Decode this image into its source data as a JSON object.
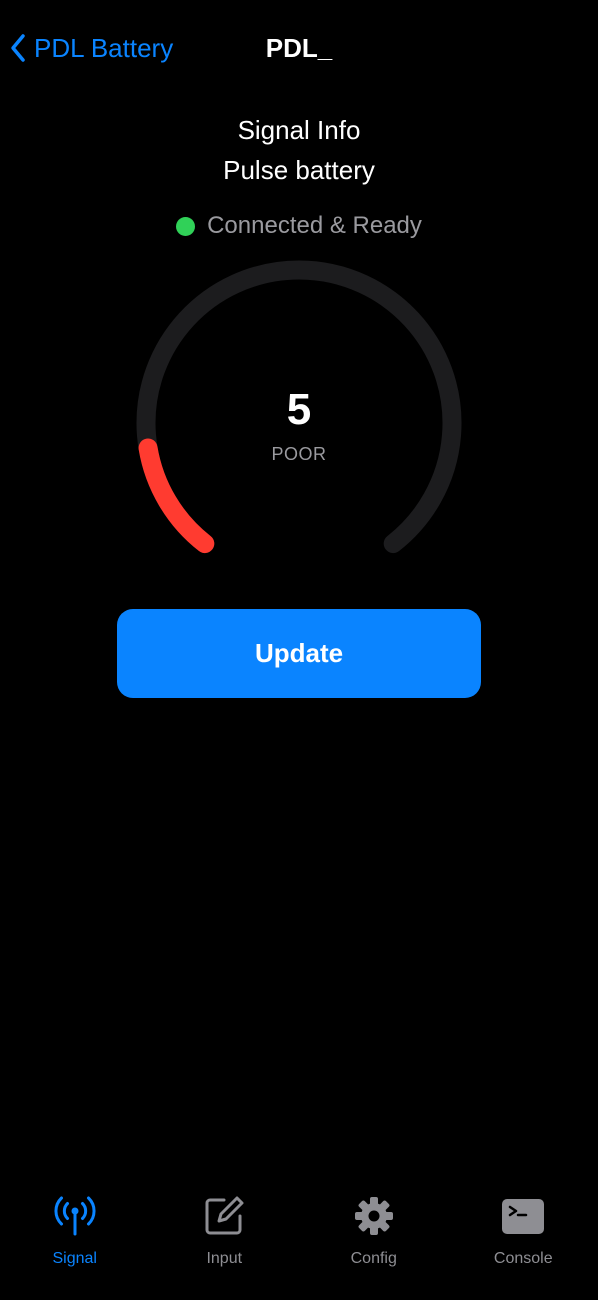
{
  "colors": {
    "accent": "#0a84ff",
    "status_ok": "#30d158",
    "gauge_low": "#ff3b30",
    "gauge_track": "#1c1c1e",
    "inactive_tab": "#8e8e93"
  },
  "nav": {
    "back_label": "PDL Battery",
    "back_icon": "chevron-left-icon",
    "title": "PDL_"
  },
  "heading": {
    "line1": "Signal Info",
    "line2": "Pulse battery"
  },
  "status": {
    "text": "Connected & Ready",
    "state": "connected"
  },
  "gauge": {
    "value": "5",
    "rating": "POOR",
    "level": 0.05
  },
  "actions": {
    "update_label": "Update"
  },
  "tabs": [
    {
      "label": "Signal",
      "icon": "antenna-icon",
      "active": true
    },
    {
      "label": "Input",
      "icon": "edit-icon",
      "active": false
    },
    {
      "label": "Config",
      "icon": "gear-icon",
      "active": false
    },
    {
      "label": "Console",
      "icon": "terminal-icon",
      "active": false
    }
  ]
}
